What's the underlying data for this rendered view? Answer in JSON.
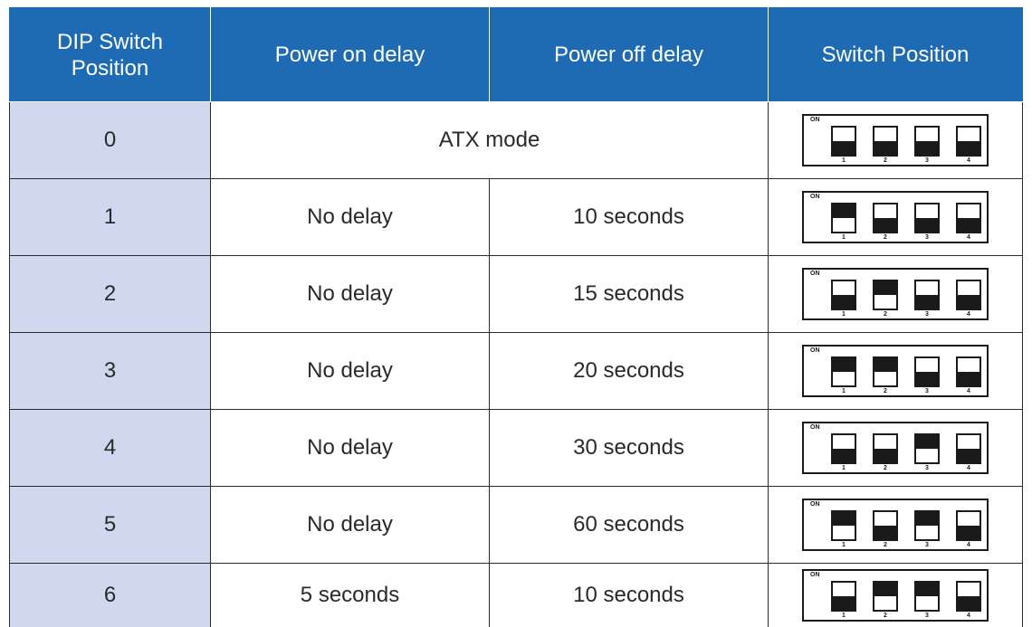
{
  "headers": {
    "dip_position": "DIP Switch Position",
    "power_on_delay": "Power on delay",
    "power_off_delay": "Power off delay",
    "switch_position": "Switch Position"
  },
  "switch_labels": {
    "on": "ON",
    "numbers": [
      "1",
      "2",
      "3",
      "4"
    ]
  },
  "rows": [
    {
      "position": "0",
      "merged_text": "ATX mode",
      "switches": [
        false,
        false,
        false,
        false
      ]
    },
    {
      "position": "1",
      "power_on": "No delay",
      "power_off": "10 seconds",
      "switches": [
        true,
        false,
        false,
        false
      ]
    },
    {
      "position": "2",
      "power_on": "No delay",
      "power_off": "15 seconds",
      "switches": [
        false,
        true,
        false,
        false
      ]
    },
    {
      "position": "3",
      "power_on": "No delay",
      "power_off": "20 seconds",
      "switches": [
        true,
        true,
        false,
        false
      ]
    },
    {
      "position": "4",
      "power_on": "No delay",
      "power_off": "30 seconds",
      "switches": [
        false,
        false,
        true,
        false
      ]
    },
    {
      "position": "5",
      "power_on": "No delay",
      "power_off": "60 seconds",
      "switches": [
        true,
        false,
        true,
        false
      ]
    },
    {
      "position": "6",
      "power_on": "5 seconds",
      "power_off": "10 seconds",
      "switches": [
        false,
        true,
        true,
        false
      ]
    }
  ],
  "colors": {
    "header_bg": "#1e6ab3",
    "position_cell_bg": "#cfd8ee",
    "switch_dark": "#1a1a1a"
  }
}
